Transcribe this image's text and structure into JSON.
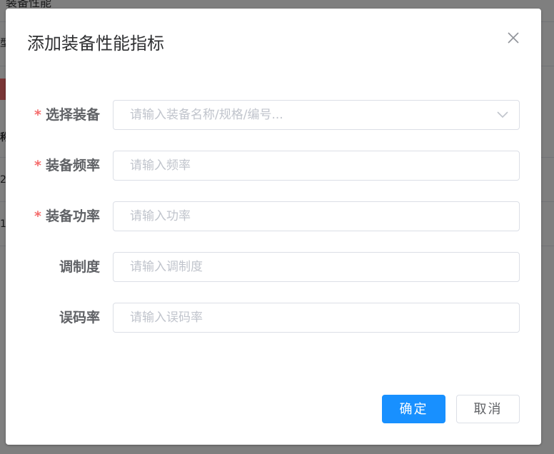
{
  "background": {
    "title": "装备性能",
    "fragments": [
      "型",
      "称",
      "2",
      "1"
    ]
  },
  "dialog": {
    "title": "添加装备性能指标",
    "close_icon": "close-icon",
    "fields": [
      {
        "label": "选择装备",
        "required": true,
        "placeholder": "请输入装备名称/规格/编号...",
        "type": "select",
        "value": ""
      },
      {
        "label": "装备频率",
        "required": true,
        "placeholder": "请输入频率",
        "type": "text",
        "value": ""
      },
      {
        "label": "装备功率",
        "required": true,
        "placeholder": "请输入功率",
        "type": "text",
        "value": ""
      },
      {
        "label": "调制度",
        "required": false,
        "placeholder": "请输入调制度",
        "type": "text",
        "value": ""
      },
      {
        "label": "误码率",
        "required": false,
        "placeholder": "请输入误码率",
        "type": "text",
        "value": ""
      }
    ],
    "required_mark": "*",
    "confirm_label": "确定",
    "cancel_label": "取消"
  },
  "colors": {
    "primary": "#1890ff",
    "required": "#f56c6c",
    "label": "#606266",
    "placeholder": "#c0c4cc",
    "border": "#dcdfe6"
  }
}
